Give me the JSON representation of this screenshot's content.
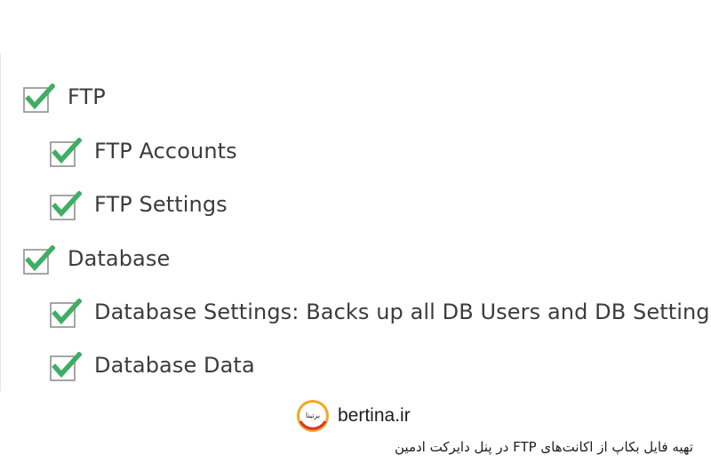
{
  "tree": {
    "items": [
      {
        "label": "FTP",
        "checked": true,
        "level": 0
      },
      {
        "label": "FTP Accounts",
        "checked": true,
        "level": 1
      },
      {
        "label": "FTP Settings",
        "checked": true,
        "level": 1
      },
      {
        "label": "Database",
        "checked": true,
        "level": 0
      },
      {
        "label": "Database Settings: Backs up all DB Users and DB Settings",
        "checked": true,
        "level": 1
      },
      {
        "label": "Database Data",
        "checked": true,
        "level": 1
      }
    ]
  },
  "watermark": {
    "site": "bertina.ir",
    "logo_text": "برتینا",
    "caption": "تهیه فایل بکاپ از اکانت‌های FTP در پنل دایرکت ادمین"
  },
  "colors": {
    "check": "#3fae64",
    "box_border": "#8f8f8f",
    "text": "#3c3c3c",
    "logo_orange": "#f5a623",
    "logo_red": "#d9342b"
  },
  "icons": {
    "checkbox": "checkbox-checked-icon",
    "logo": "bertina-logo-icon"
  }
}
